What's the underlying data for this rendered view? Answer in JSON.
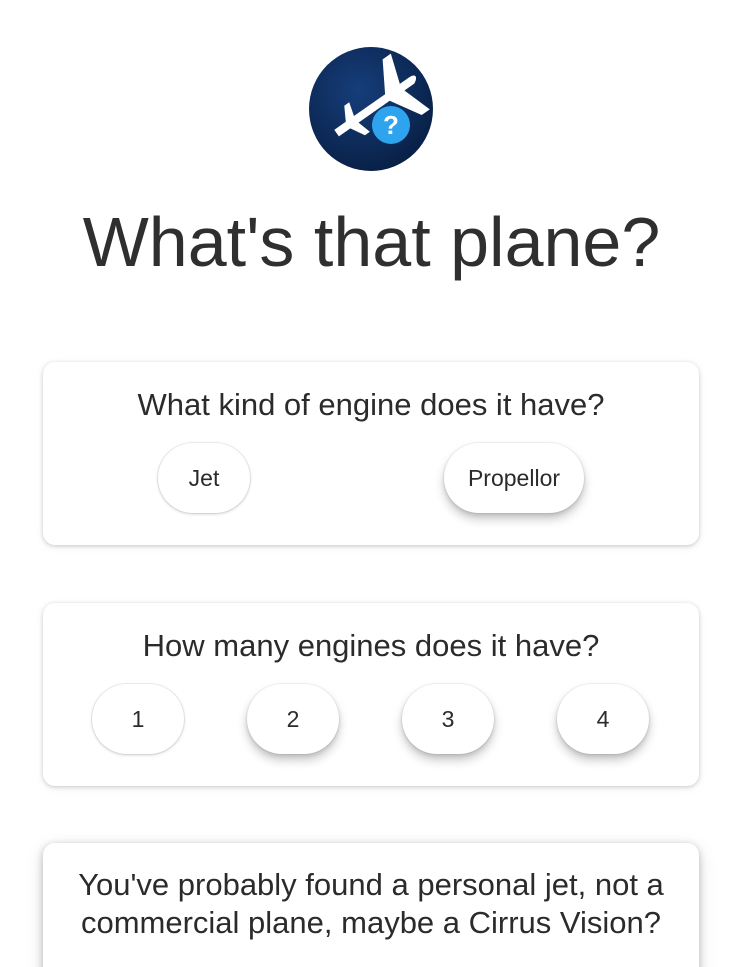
{
  "app": {
    "title": "What's that plane?",
    "logo_icon": "plane-question-icon",
    "colors": {
      "logo_background": "#0b2a5b",
      "badge": "#2ea3ee",
      "plane": "#ffffff"
    }
  },
  "question_engine_type": {
    "prompt": "What kind of engine does it have?",
    "options": [
      "Jet",
      "Propellor"
    ]
  },
  "question_engine_count": {
    "prompt": "How many engines does it have?",
    "options": [
      "1",
      "2",
      "3",
      "4"
    ]
  },
  "result": {
    "text": "You've probably found a personal jet, not a commercial plane, maybe a Cirrus Vision?"
  },
  "logo": {
    "badge_glyph": "?"
  }
}
